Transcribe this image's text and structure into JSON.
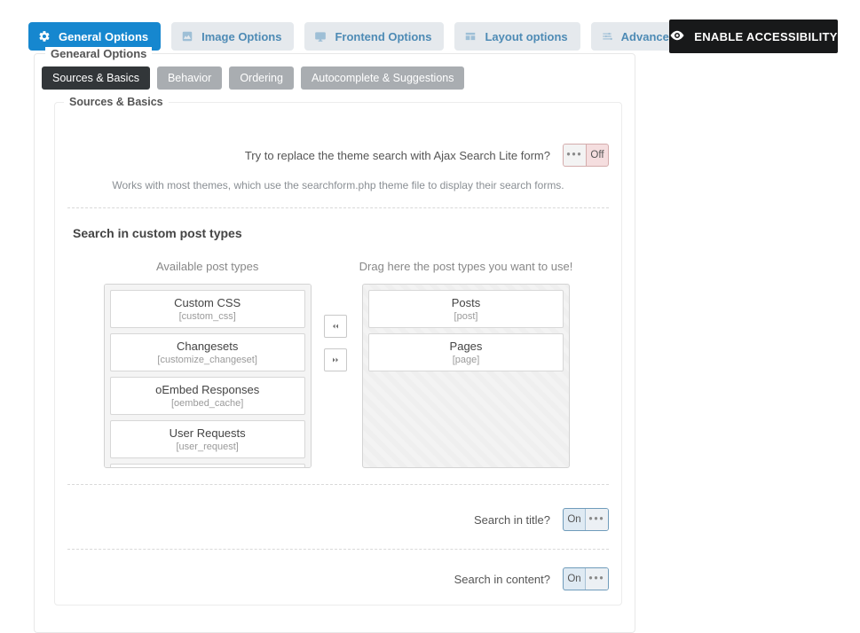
{
  "tabs": {
    "general": "General Options",
    "image": "Image Options",
    "frontend": "Frontend Options",
    "layout": "Layout options",
    "advanced": "Advanced"
  },
  "accessibility_label": "ENABLE ACCESSIBILITY",
  "fieldset_title": "Genearal Options",
  "sub_tabs": {
    "sources": "Sources & Basics",
    "behavior": "Behavior",
    "ordering": "Ordering",
    "autocomplete": "Autocomplete & Suggestions"
  },
  "inner_title": "Sources & Basics",
  "replace_search": {
    "label": "Try to replace the theme search with Ajax Search Lite form?",
    "state": "Off",
    "hint": "Works with most themes, which use the searchform.php theme file to display their search forms."
  },
  "custom_pt_title": "Search in custom post types",
  "headers": {
    "available": "Available post types",
    "drag": "Drag here the post types you want to use!"
  },
  "available": [
    {
      "name": "Custom CSS",
      "slug": "[custom_css]"
    },
    {
      "name": "Changesets",
      "slug": "[customize_changeset]"
    },
    {
      "name": "oEmbed Responses",
      "slug": "[oembed_cache]"
    },
    {
      "name": "User Requests",
      "slug": "[user_request]"
    }
  ],
  "selected": [
    {
      "name": "Posts",
      "slug": "[post]"
    },
    {
      "name": "Pages",
      "slug": "[page]"
    }
  ],
  "toggles": {
    "search_title": {
      "label": "Search in title?",
      "state": "On"
    },
    "search_content": {
      "label": "Search in content?",
      "state": "On"
    }
  },
  "dots": "•••"
}
